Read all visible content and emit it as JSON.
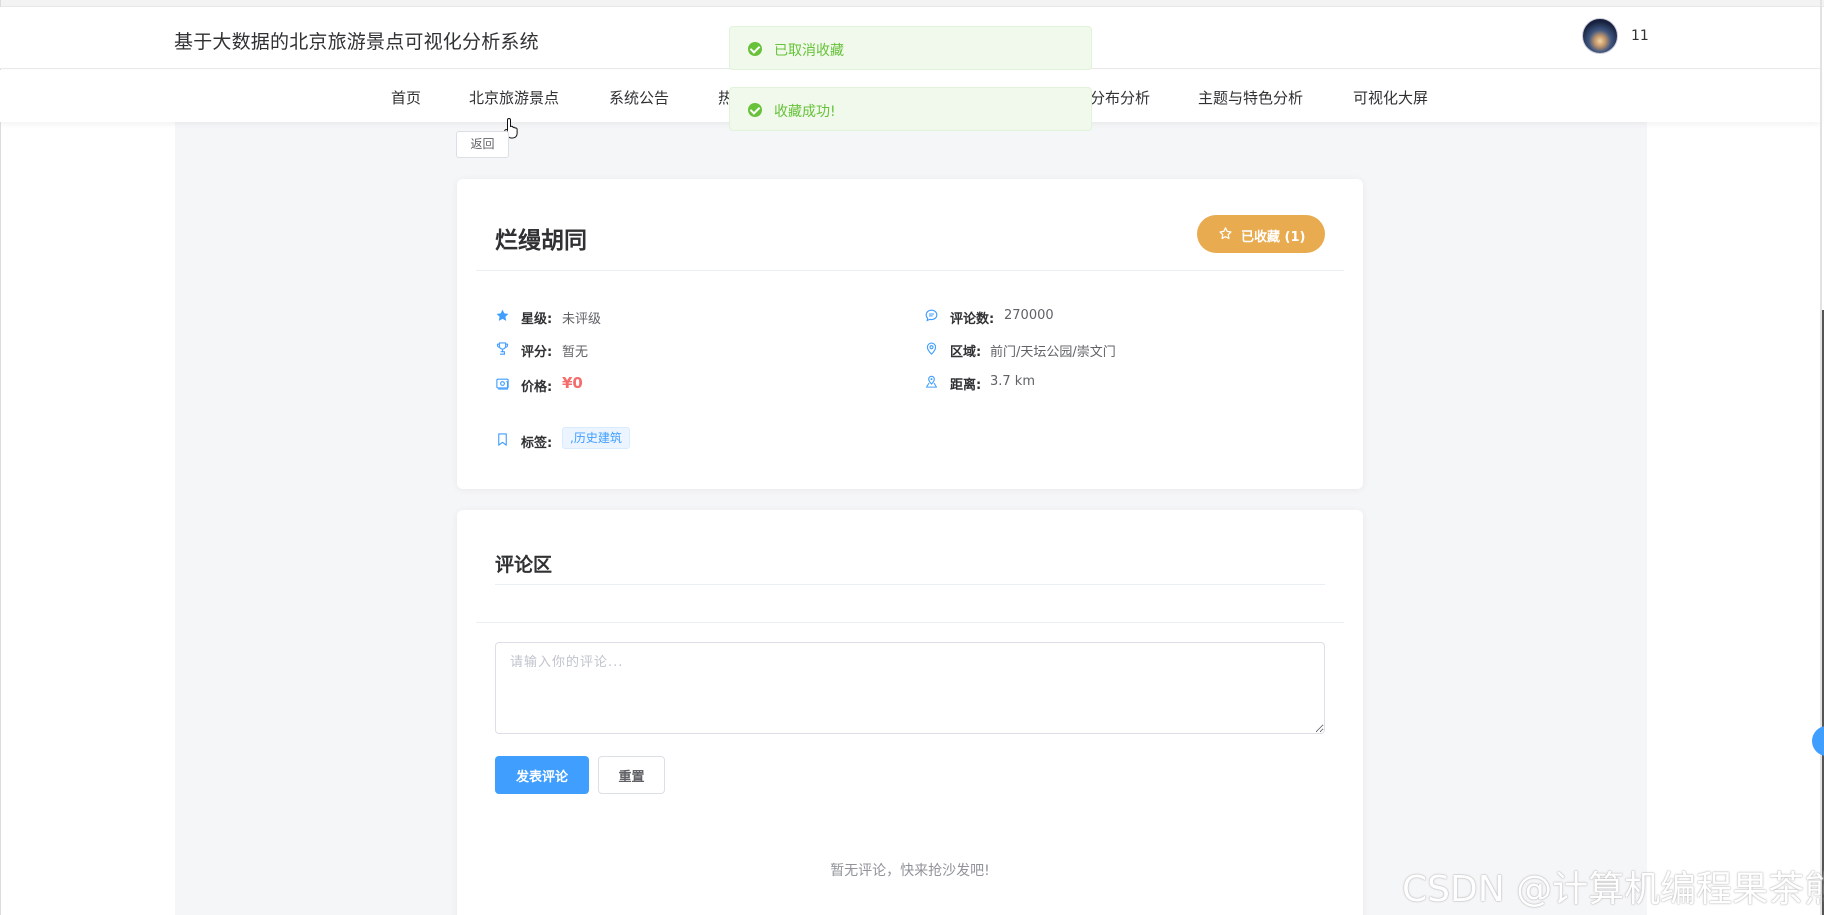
{
  "header": {
    "site_title": "基于大数据的北京旅游景点可视化分析系统",
    "username": "11"
  },
  "nav": {
    "items": [
      {
        "label": "首页"
      },
      {
        "label": "北京旅游景点"
      },
      {
        "label": "系统公告"
      },
      {
        "label": "热"
      },
      {
        "label": "分布分析"
      },
      {
        "label": "主题与特色分析"
      },
      {
        "label": "可视化大屏"
      }
    ]
  },
  "toasts": [
    {
      "text": "已取消收藏"
    },
    {
      "text": "收藏成功!"
    }
  ],
  "back_label": "返回",
  "spot": {
    "name": "烂缦胡同",
    "favorite_label": "已收藏 (1)",
    "star_label": "星级:",
    "star_value": "未评级",
    "rating_label": "评分:",
    "rating_value": "暂无",
    "price_label": "价格:",
    "price_value": "¥0",
    "comments_label": "评论数:",
    "comments_value": "270000",
    "area_label": "区域:",
    "area_value": "前门/天坛公园/崇文门",
    "distance_label": "距离:",
    "distance_value": "3.7 km",
    "tags_label": "标签:",
    "tag_value": ",历史建筑"
  },
  "comments": {
    "section_title": "评论区",
    "placeholder": "请输入你的评论...",
    "submit_label": "发表评论",
    "reset_label": "重置",
    "empty_text": "暂无评论，快来抢沙发吧!"
  },
  "watermark": "CSDN @计算机编程果茶熊",
  "colors": {
    "primary": "#409eff",
    "favorite": "#e6a23c",
    "success": "#67c23a",
    "price": "#f56c6c"
  }
}
